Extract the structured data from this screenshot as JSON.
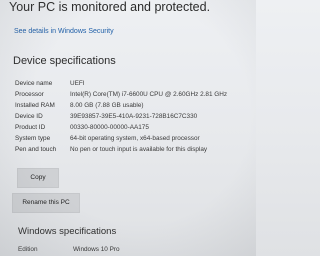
{
  "banner": {
    "text": "Your PC is monitored and protected."
  },
  "security_link": {
    "label": "See details in Windows Security"
  },
  "device_specs": {
    "title": "Device specifications",
    "rows": [
      {
        "key": "Device name",
        "value": "UEFI"
      },
      {
        "key": "Processor",
        "value": "Intel(R) Core(TM) i7-6600U CPU @ 2.60GHz   2.81 GHz"
      },
      {
        "key": "Installed RAM",
        "value": "8.00 GB (7.88 GB usable)"
      },
      {
        "key": "Device ID",
        "value": "39E93857-39E5-410A-9231-728B16C7C330"
      },
      {
        "key": "Product ID",
        "value": "00330-80000-00000-AA175"
      },
      {
        "key": "System type",
        "value": "64-bit operating system, x64-based processor"
      },
      {
        "key": "Pen and touch",
        "value": "No pen or touch input is available for this display"
      }
    ]
  },
  "buttons": {
    "copy": "Copy",
    "rename": "Rename this PC"
  },
  "windows_specs": {
    "title": "Windows specifications",
    "edition_key": "Edition",
    "edition_value": "Windows 10 Pro"
  }
}
